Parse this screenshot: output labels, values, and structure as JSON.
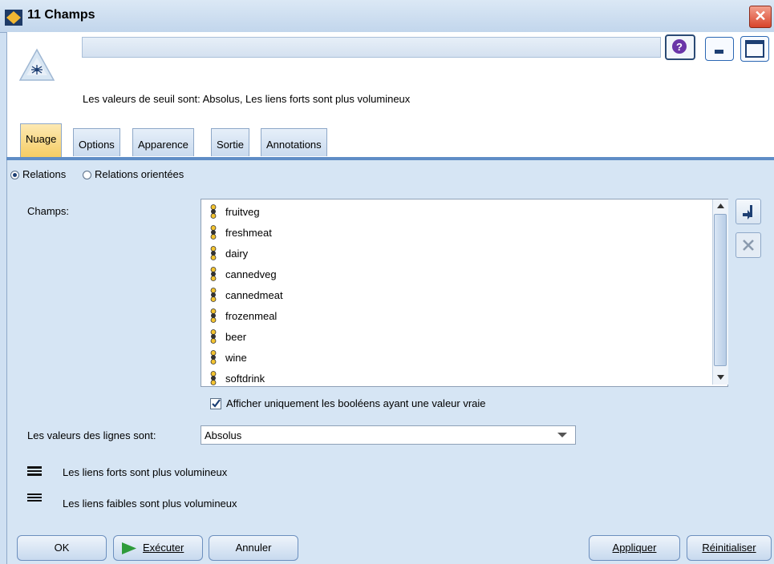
{
  "window": {
    "title": "11 Champs",
    "close_label": "✕"
  },
  "header": {
    "node_name": "",
    "summary": "Les valeurs de seuil sont: Absolus,  Les liens forts sont plus volumineux"
  },
  "tabs": [
    {
      "label": "Nuage",
      "active": true
    },
    {
      "label": "Options",
      "active": false
    },
    {
      "label": "Apparence",
      "active": false
    },
    {
      "label": "Sortie",
      "active": false
    },
    {
      "label": "Annotations",
      "active": false
    }
  ],
  "mode": {
    "relations_label": "Relations",
    "directed_label": "Relations orientées",
    "selected": "Relations"
  },
  "fields": {
    "label": "Champs:",
    "items": [
      "fruitveg",
      "freshmeat",
      "dairy",
      "cannedveg",
      "cannedmeat",
      "frozenmeal",
      "beer",
      "wine",
      "softdrink"
    ]
  },
  "only_true_checkbox": {
    "label": "Afficher uniquement les booléens ayant une valeur vraie",
    "checked": true
  },
  "line_values": {
    "label": "Les valeurs des lignes sont:",
    "value": "Absolus"
  },
  "link_options": {
    "strong_label": "Les liens forts sont plus volumineux",
    "weak_label": "Les liens faibles sont plus volumineux"
  },
  "buttons": {
    "ok": "OK",
    "run": "Exécuter",
    "cancel": "Annuler",
    "apply": "Appliquer",
    "reset": "Réinitialiser"
  },
  "colors": {
    "accent": "#5f8dc6",
    "active_tab": "#f5cc62",
    "run_arrow": "#2e9b3a"
  }
}
